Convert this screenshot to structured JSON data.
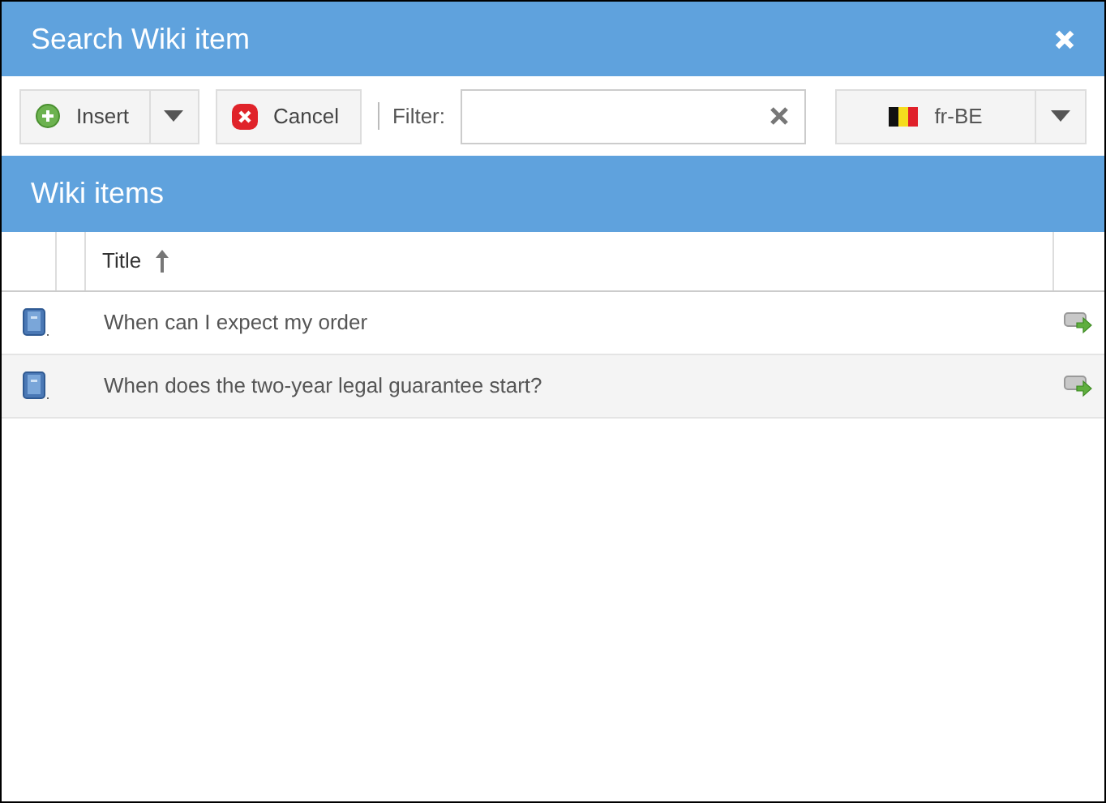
{
  "window": {
    "title": "Search Wiki item"
  },
  "toolbar": {
    "insert": "Insert",
    "cancel": "Cancel",
    "filter_label": "Filter:",
    "language": "fr-BE"
  },
  "section": {
    "title": "Wiki items"
  },
  "table": {
    "columns": [
      "Title"
    ],
    "sort_ascending": true,
    "rows": [
      {
        "title": "When can I expect my order"
      },
      {
        "title": "When does the two-year legal guarantee start?"
      }
    ]
  }
}
